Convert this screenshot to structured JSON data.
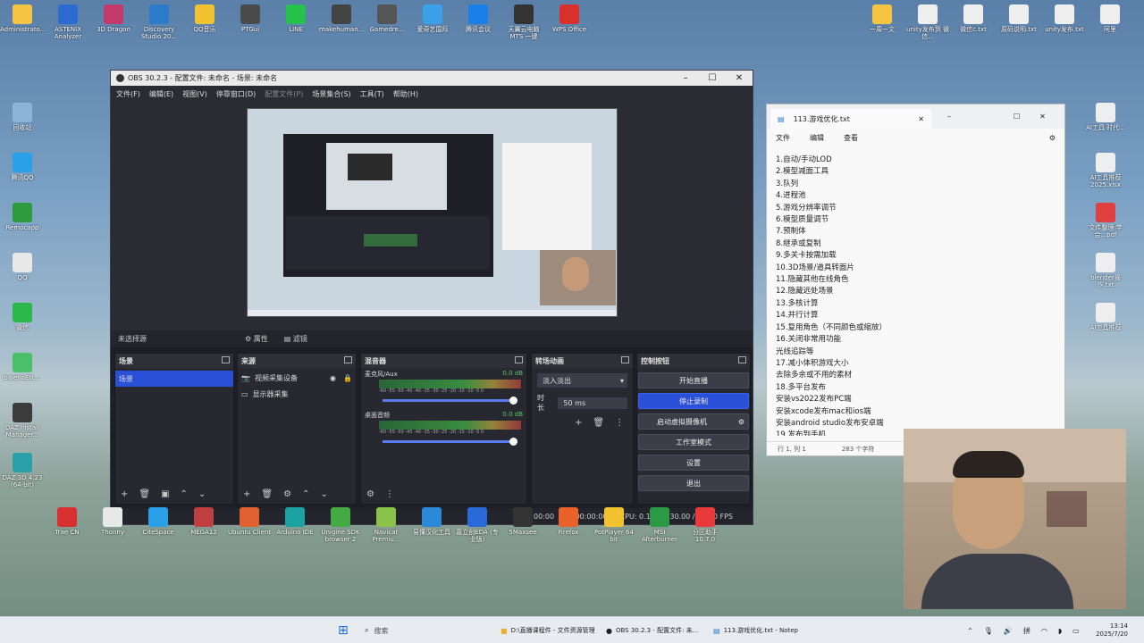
{
  "desktop": {
    "left_icons": [
      {
        "label": "Administrato...",
        "color": "#f5c542"
      },
      {
        "label": "ASTENIX Analyzer",
        "color": "#2c6bd1"
      },
      {
        "label": "3D Dragon",
        "color": "#c43a6a"
      },
      {
        "label": "Discovery Studio 20...",
        "color": "#2a7bc8"
      },
      {
        "label": "QQ音乐",
        "color": "#f2c230"
      },
      {
        "label": "PTGui",
        "color": "#4b4b4b"
      },
      {
        "label": "LINE",
        "color": "#25c14a"
      },
      {
        "label": "makehuman...",
        "color": "#444"
      },
      {
        "label": "Gamedre...",
        "color": "#555"
      },
      {
        "label": "爱奇艺国际",
        "color": "#3aa0e8"
      },
      {
        "label": "腾讯会议",
        "color": "#1a7fe8"
      },
      {
        "label": "天翼云电脑 MTS 一键",
        "color": "#333"
      },
      {
        "label": "WPS Office",
        "color": "#d8302a"
      }
    ],
    "col1": [
      {
        "label": "回收站",
        "color": "#8cb4d8"
      },
      {
        "label": "腾讯QQ",
        "color": "#2aa0e8"
      },
      {
        "label": "Remocapp",
        "color": "#2e9a3e"
      },
      {
        "label": "QQ",
        "color": "#e8e8e8"
      },
      {
        "label": "微信",
        "color": "#2ab84a"
      },
      {
        "label": "balenaEtc...",
        "color": "#4bbf6a"
      },
      {
        "label": "DAZ Install Manager...",
        "color": "#3b3b3b"
      },
      {
        "label": "DAZ 3D 4.23 (64-bit)",
        "color": "#2aa0a8"
      }
    ],
    "bottom_row": [
      {
        "label": "Trae CN",
        "color": "#d83030"
      },
      {
        "label": "Thonny",
        "color": "#e8e8e8"
      },
      {
        "label": "CiteSpace",
        "color": "#2aa0e8"
      },
      {
        "label": "MEGA12",
        "color": "#c04040"
      },
      {
        "label": "Ubuntu Client",
        "color": "#e06030"
      },
      {
        "label": "Arduino IDE",
        "color": "#1ba3a3"
      },
      {
        "label": "Unigine SDK browser 2",
        "color": "#44aa44"
      },
      {
        "label": "Navicat Premiu...",
        "color": "#8ac34a"
      },
      {
        "label": "易懂汉化工具",
        "color": "#2a8ad8"
      },
      {
        "label": "嘉立创EDA (专业版)",
        "color": "#2a6ad8"
      },
      {
        "label": "5Maxsee",
        "color": "#333"
      },
      {
        "label": "Firefox",
        "color": "#e8622a"
      },
      {
        "label": "PotPlayer 64 bit",
        "color": "#f2c230"
      },
      {
        "label": "MSI Afterburner",
        "color": "#2a9a44"
      },
      {
        "label": "分区助手 10.7.0",
        "color": "#e83a3a"
      }
    ],
    "right_icons": [
      {
        "label": "一周一文",
        "color": "#f5c542"
      },
      {
        "label": "unity发布到 微信...",
        "color": "#eee"
      },
      {
        "label": "微信c.txt",
        "color": "#eee"
      },
      {
        "label": "原码说明.txt",
        "color": "#eee"
      },
      {
        "label": "unity发布.txt",
        "color": "#eee"
      },
      {
        "label": "阿里",
        "color": "#eee"
      }
    ],
    "right_col2": [
      {
        "label": "AI工具 时代...",
        "color": "#eee"
      },
      {
        "label": "AI工具推荐 2025.xlsx",
        "color": "#eee"
      },
      {
        "label": "文件整理 学会...pdf",
        "color": "#e04040"
      },
      {
        "label": "blender操作.txt",
        "color": "#eee"
      },
      {
        "label": "AI工具推荐",
        "color": "#eee"
      }
    ]
  },
  "obs": {
    "title": "OBS 30.2.3 - 配置文件: 未命名 - 场景: 未命名",
    "menu": [
      "文件(F)",
      "编辑(E)",
      "视图(V)",
      "停靠窗口(D)",
      "配置文件(P)",
      "场景集合(S)",
      "工具(T)",
      "帮助(H)"
    ],
    "scene_bar": {
      "label": "未选择源",
      "props": "属性",
      "filters": "滤镜"
    },
    "scenes": {
      "title": "场景",
      "items": [
        "场景"
      ]
    },
    "sources": {
      "title": "来源",
      "items": [
        "视频采集设备",
        "显示器采集"
      ]
    },
    "mixer": {
      "title": "混音器",
      "channels": [
        {
          "name": "麦克风/Aux",
          "db": "0.0 dB"
        },
        {
          "name": "桌面音频",
          "db": "0.0 dB"
        }
      ],
      "scale": "-60 -55 -50 -45 -40 -35 -30 -25 -20 -15 -10 -5 0"
    },
    "transitions": {
      "title": "转场动画",
      "selected": "淡入淡出",
      "duration_label": "时长",
      "duration": "50 ms"
    },
    "controls": {
      "title": "控制按钮",
      "buttons": [
        "开始直播",
        "停止录制",
        "启动虚拟摄像机",
        "工作室模式",
        "设置",
        "退出"
      ]
    },
    "status": {
      "stream_time": "00:00:00",
      "rec_time": "00:00:00",
      "cpu": "CPU: 0.1%",
      "fps": "30.00 / 30.00 FPS"
    }
  },
  "notepad": {
    "tab": "113.游戏优化.txt",
    "menu": [
      "文件",
      "编辑",
      "查看"
    ],
    "lines": [
      "1.自动/手动LOD",
      "2.模型减面工具",
      "3.队列",
      "4.进程池",
      "5.游戏分辨率调节",
      "6.模型质量调节",
      "7.预制体",
      "8.继承或复制",
      "9.多关卡按需加载",
      "10.3D场景/道具转面片",
      "11.隐藏其他在线角色",
      "12.隐藏远处场景",
      "13.多核计算",
      "14.并行计算",
      "15.复用角色（不同颜色或缩放）",
      "16.关闭非常用功能",
      "光线追踪等",
      "17.减小体积游戏大小",
      "去除多余或不用的素材",
      "18.多平台发布",
      "安装vs2022发布PC端",
      "安装xcode发布mac和ios端",
      "安装android studio发布安卓端",
      "19.发布到手机"
    ],
    "status": {
      "pos": "行 1, 列 1",
      "chars": "283 个字符"
    }
  },
  "taskbar": {
    "search": "搜索",
    "items": [
      "D:\\直播课程件 - 文件资源管理",
      "OBS 30.2.3 - 配置文件: 未...",
      "113.游戏优化.txt - Notep"
    ],
    "lang": "拼",
    "time": "13:14",
    "date": "2025/7/20"
  }
}
